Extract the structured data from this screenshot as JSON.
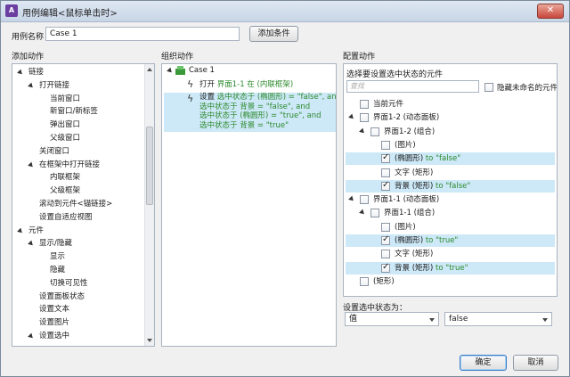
{
  "window": {
    "title": "用例编辑<鼠标单击时>",
    "app_icon": "axure-icon",
    "close_label": "✕"
  },
  "header": {
    "case_name_label": "用例名称",
    "case_name_value": "Case 1",
    "add_condition_label": "添加条件"
  },
  "columns": {
    "add_action": "添加动作",
    "organize_action": "组织动作",
    "configure_action": "配置动作"
  },
  "left_tree": [
    {
      "label": "链接",
      "level": 0,
      "expanded": true
    },
    {
      "label": "打开链接",
      "level": 1,
      "expanded": true
    },
    {
      "label": "当前窗口",
      "level": 2
    },
    {
      "label": "新窗口/新标签",
      "level": 2
    },
    {
      "label": "弹出窗口",
      "level": 2
    },
    {
      "label": "父级窗口",
      "level": 2
    },
    {
      "label": "关闭窗口",
      "level": 1
    },
    {
      "label": "在框架中打开链接",
      "level": 1,
      "expanded": true
    },
    {
      "label": "内联框架",
      "level": 2
    },
    {
      "label": "父级框架",
      "level": 2
    },
    {
      "label": "滚动到元件<锚链接>",
      "level": 1
    },
    {
      "label": "设置自适应视图",
      "level": 1
    },
    {
      "label": "元件",
      "level": 0,
      "expanded": true
    },
    {
      "label": "显示/隐藏",
      "level": 1,
      "expanded": true
    },
    {
      "label": "显示",
      "level": 2
    },
    {
      "label": "隐藏",
      "level": 2
    },
    {
      "label": "切换可见性",
      "level": 2
    },
    {
      "label": "设置面板状态",
      "level": 1
    },
    {
      "label": "设置文本",
      "level": 1
    },
    {
      "label": "设置图片",
      "level": 1
    },
    {
      "label": "设置选中",
      "level": 1,
      "expanded": true
    }
  ],
  "middle": {
    "case_label": "Case 1",
    "action1_prefix": "打开",
    "action1_detail": "界面1-1 在 (内联框架)",
    "action2_prefix": "设置",
    "action2_lines": [
      "选中状态于 (椭圆形) = \"false\", and",
      "选中状态于 背景 = \"false\", and",
      "选中状态于 (椭圆形) = \"true\", and",
      "选中状态于 背景 = \"true\""
    ]
  },
  "right": {
    "select_widgets_label": "选择要设置选中状态的元件",
    "search_placeholder": "查找",
    "hide_unnamed_label": "隐藏未命名的元件",
    "tree": [
      {
        "label": "当前元件",
        "level": 0,
        "checked": false,
        "suffix": ""
      },
      {
        "label": "界面1-2 (动态面板)",
        "level": 0,
        "checked": false,
        "expanded": true,
        "suffix": ""
      },
      {
        "label": "界面1-2 (组合)",
        "level": 1,
        "checked": false,
        "expanded": true,
        "suffix": ""
      },
      {
        "label": "(图片)",
        "level": 2,
        "checked": false,
        "suffix": ""
      },
      {
        "label": "(椭圆形)",
        "level": 2,
        "checked": true,
        "suffix": " to \"false\""
      },
      {
        "label": "文字 (矩形)",
        "level": 2,
        "checked": false,
        "suffix": ""
      },
      {
        "label": "背景 (矩形)",
        "level": 2,
        "checked": true,
        "suffix": " to \"false\""
      },
      {
        "label": "界面1-1 (动态面板)",
        "level": 0,
        "checked": false,
        "expanded": true,
        "suffix": ""
      },
      {
        "label": "界面1-1 (组合)",
        "level": 1,
        "checked": false,
        "expanded": true,
        "suffix": ""
      },
      {
        "label": "(图片)",
        "level": 2,
        "checked": false,
        "suffix": ""
      },
      {
        "label": "(椭圆形)",
        "level": 2,
        "checked": true,
        "suffix": " to \"true\""
      },
      {
        "label": "文字 (矩形)",
        "level": 2,
        "checked": false,
        "suffix": ""
      },
      {
        "label": "背景 (矩形)",
        "level": 2,
        "checked": true,
        "suffix": " to \"true\""
      },
      {
        "label": "(矩形)",
        "level": 0,
        "checked": false,
        "suffix": ""
      }
    ],
    "set_selected_label": "设置选中状态为：",
    "value_type": "值",
    "value": "false"
  },
  "footer": {
    "ok_label": "确定",
    "cancel_label": "取消"
  },
  "colors": {
    "selection_bg": "#cde8f7",
    "green_text": "#2c8a2c"
  }
}
